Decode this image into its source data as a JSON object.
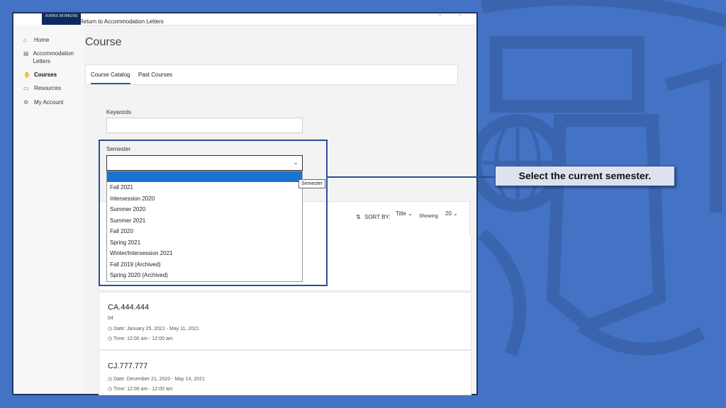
{
  "logo_text": "JOHNS HOPKINS",
  "sidebar": {
    "items": [
      {
        "label": "Home",
        "icon": "home-icon"
      },
      {
        "label": "Accommodation Letters",
        "icon": "document-icon"
      },
      {
        "label": "Courses",
        "icon": "hand-icon"
      },
      {
        "label": "Resources",
        "icon": "folder-icon"
      },
      {
        "label": "My Account",
        "icon": "gear-icon"
      }
    ]
  },
  "breadcrumb": "Return to Accommodation Letters",
  "page_title": "Course",
  "tabs": [
    "Course Catalog",
    "Past Courses"
  ],
  "filters": {
    "keywords_label": "Keywords",
    "semester_label": "Semester",
    "semester_value": "",
    "semester_options": [
      "Fall 2021",
      "Intersession 2020",
      "Summer 2020",
      "Summer 2021",
      "Fall 2020",
      "Spring 2021",
      "Winter/Intersession 2021",
      "Fall 2019 (Archived)",
      "Spring 2020 (Archived)"
    ],
    "tooltip": "Semester"
  },
  "sort": {
    "label": "SORT BY:",
    "value": "Title",
    "showing_label": "Showing",
    "showing_value": "20"
  },
  "courses": [
    {
      "code": "CA.444.444",
      "section": "04",
      "date": "Date: January 25, 2021 - May 11, 2021",
      "time": "Time: 12:00 am - 12:00 am"
    },
    {
      "code": "CJ.777.777",
      "section": "",
      "date": "Date: December 21, 2020 - May 14, 2021",
      "time": "Time: 12:00 am - 12:00 am"
    }
  ],
  "callout": "Select the current semester.",
  "colors": {
    "background": "#4472c4",
    "accent": "#2b4d92",
    "selected_option": "#1a73d1"
  }
}
